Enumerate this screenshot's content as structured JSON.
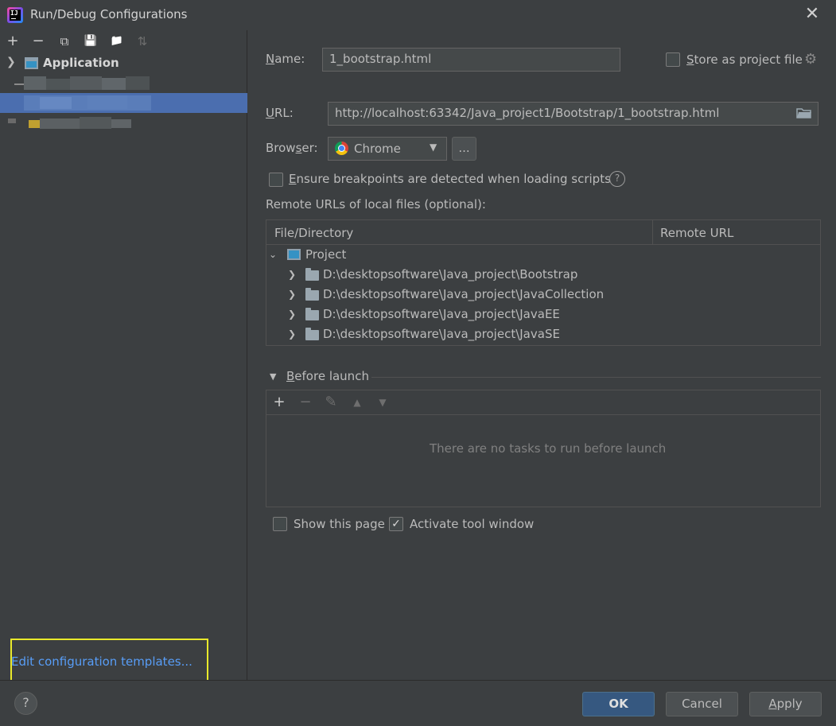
{
  "window": {
    "title": "Run/Debug Configurations",
    "close_glyph": "✕"
  },
  "left": {
    "toolbar": {
      "add": "+",
      "remove": "−",
      "copy": "⧉",
      "save": "💾",
      "folder": "📁",
      "sort": "⇅"
    },
    "tree": {
      "application_label": "Application"
    },
    "edit_templates_link": "Edit configuration templates..."
  },
  "config": {
    "name_label_prefix": "N",
    "name_label_rest": "ame:",
    "name_value": "1_bootstrap.html",
    "store_label_prefix": "S",
    "store_label_rest": "tore as project file",
    "url_label_prefix": "U",
    "url_label_rest": "RL:",
    "url_value": "http://localhost:63342/Java_project1/Bootstrap/1_bootstrap.html",
    "browser_label_a": "Brow",
    "browser_label_u": "s",
    "browser_label_b": "er:",
    "browser_value": "Chrome",
    "browser_more": "...",
    "ensure_label_prefix": "E",
    "ensure_label_rest": "nsure breakpoints are detected when loading scripts",
    "help_glyph": "?",
    "remote_urls_label": "Remote URLs of local files (optional):"
  },
  "mapping_table": {
    "columns": [
      "File/Directory",
      "Remote URL"
    ],
    "root": "Project",
    "rows": [
      "D:\\desktopsoftware\\Java_project\\Bootstrap",
      "D:\\desktopsoftware\\Java_project\\JavaCollection",
      "D:\\desktopsoftware\\Java_project\\JavaEE",
      "D:\\desktopsoftware\\Java_project\\JavaSE"
    ]
  },
  "before_launch": {
    "label_prefix": "B",
    "label_rest": "efore launch",
    "toolbar": {
      "add": "+",
      "remove": "−",
      "edit": "✎",
      "up": "▲",
      "down": "▼"
    },
    "empty_text": "There are no tasks to run before launch"
  },
  "options": {
    "show_page": "Show this page",
    "activate_tool_window": "Activate tool window",
    "check_glyph": "✓"
  },
  "buttons": {
    "help": "?",
    "ok": "OK",
    "cancel": "Cancel",
    "apply_prefix": "A",
    "apply_rest": "pply"
  }
}
